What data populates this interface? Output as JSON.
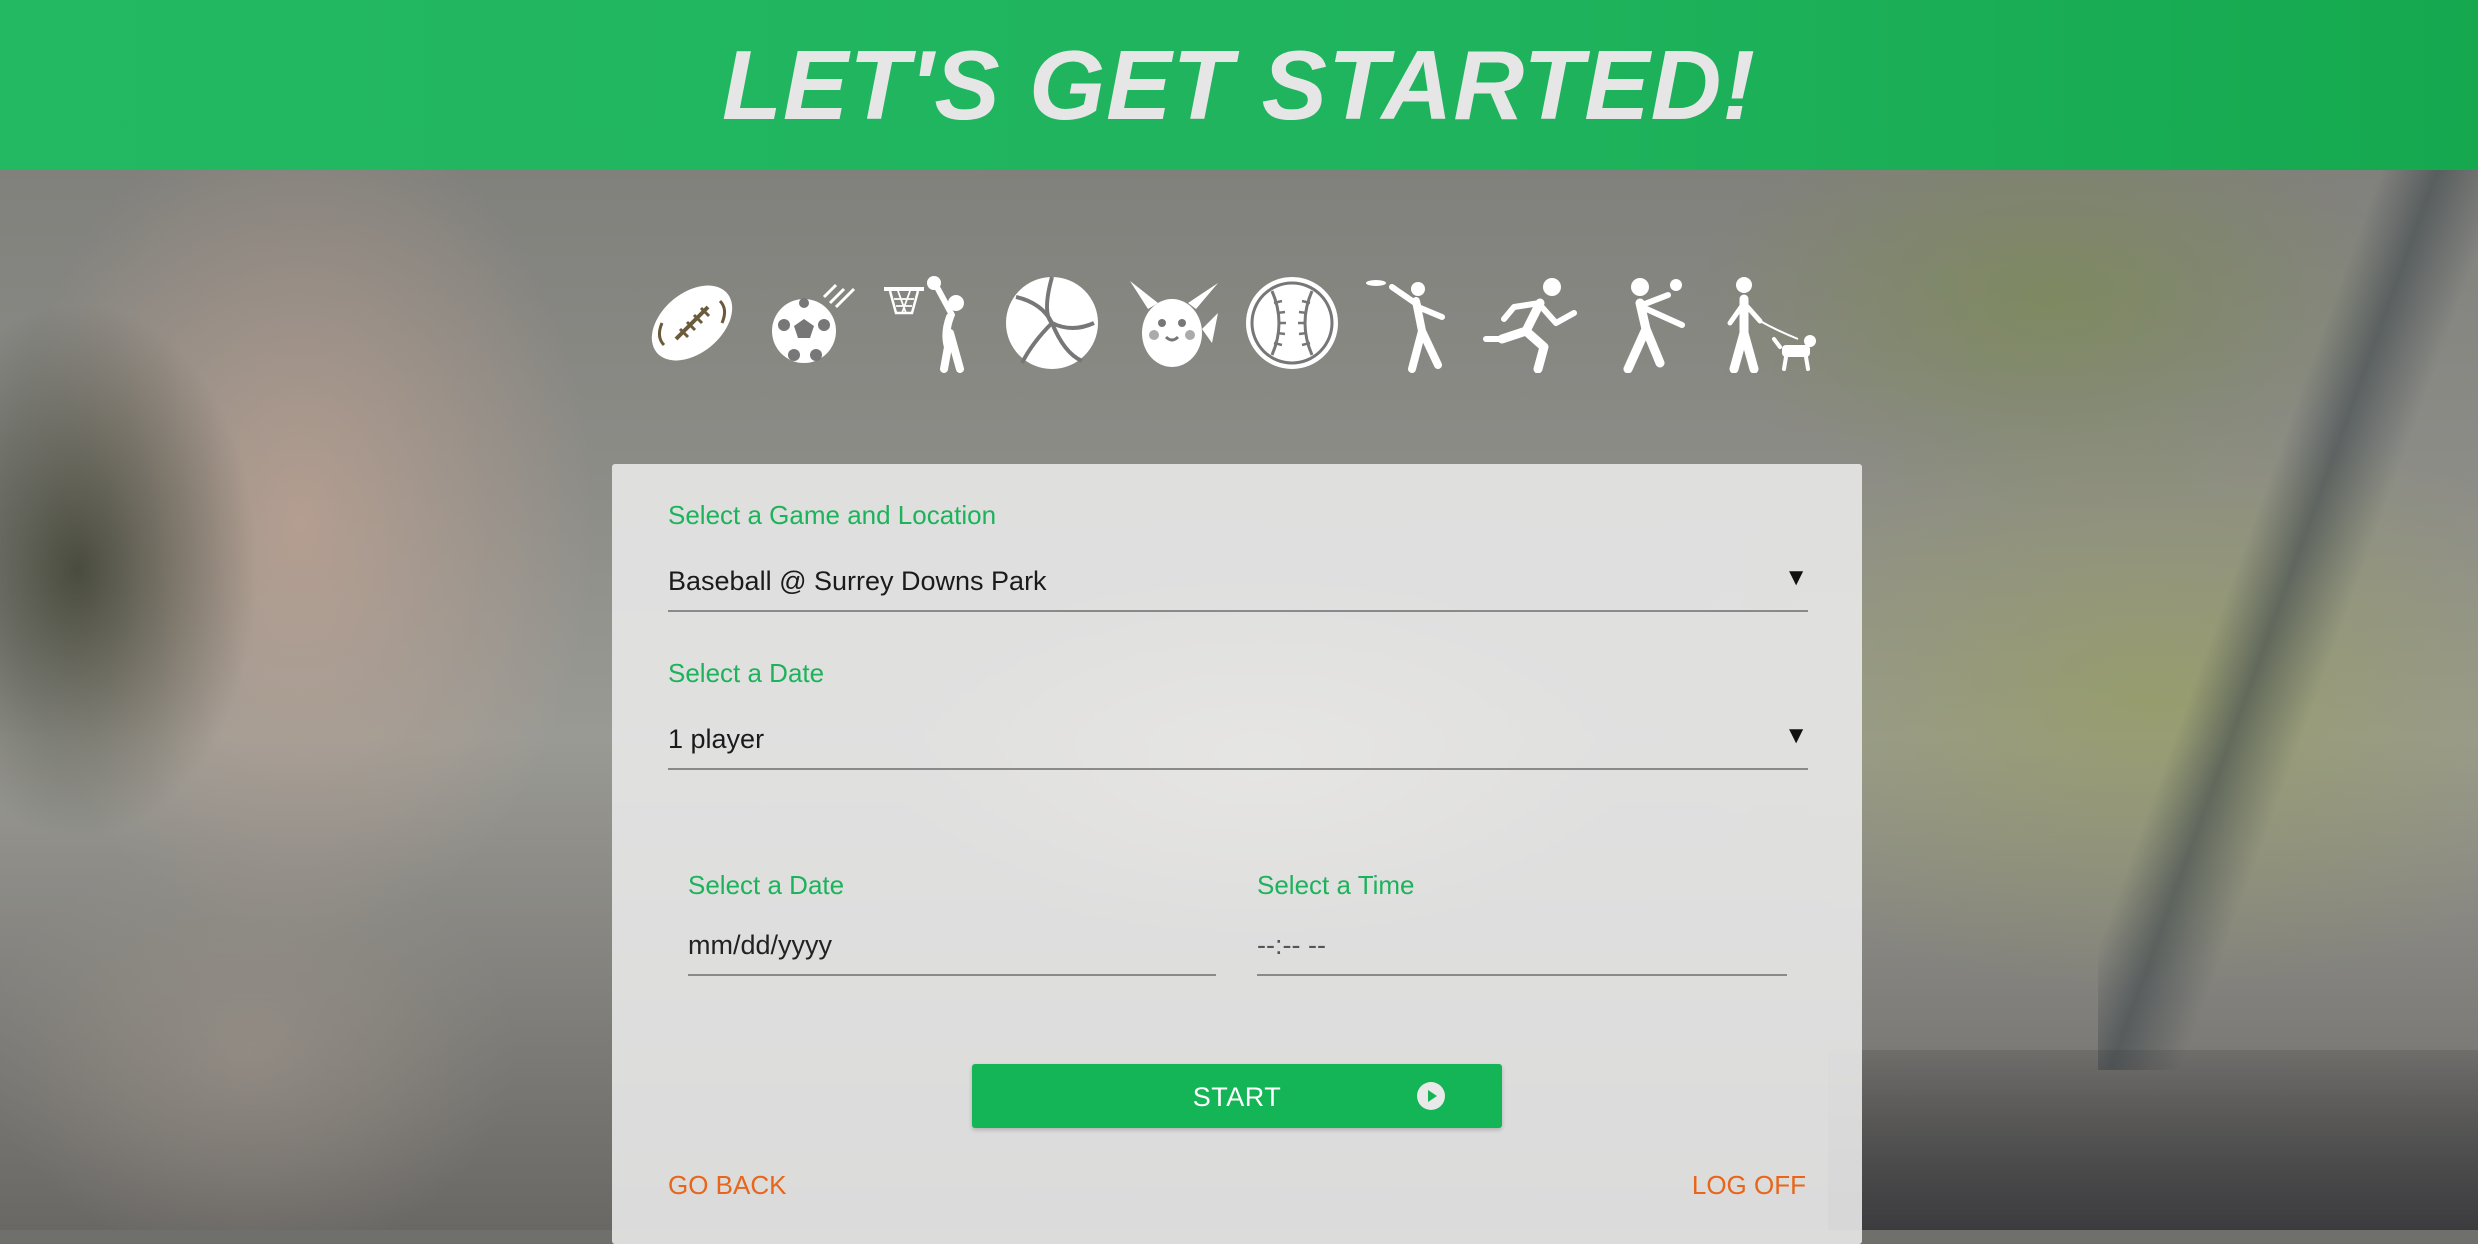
{
  "header": {
    "title": "LET'S GET STARTED!"
  },
  "sports": [
    {
      "name": "football-icon",
      "selected": true
    },
    {
      "name": "soccer-icon"
    },
    {
      "name": "basketball-icon"
    },
    {
      "name": "volleyball-icon"
    },
    {
      "name": "pokemon-go-icon"
    },
    {
      "name": "baseball-icon"
    },
    {
      "name": "frisbee-icon"
    },
    {
      "name": "running-icon"
    },
    {
      "name": "handball-icon"
    },
    {
      "name": "dog-walking-icon"
    }
  ],
  "form": {
    "game_location_label": "Select a Game and Location",
    "game_location_value": "Baseball @ Surrey Downs Park",
    "players_label": "Select a Date",
    "players_value": "1 player",
    "date_label": "Select a Date",
    "date_placeholder": "mm/dd/yyyy",
    "time_label": "Select a Time",
    "time_placeholder": "--:-- --",
    "dropdown_arrow": "▼",
    "start_label": "START"
  },
  "links": {
    "go_back": "GO BACK",
    "log_off": "LOG OFF"
  },
  "colors": {
    "brand_green": "#1db35c",
    "link_orange": "#e8651a",
    "icon_white": "#ffffff"
  }
}
